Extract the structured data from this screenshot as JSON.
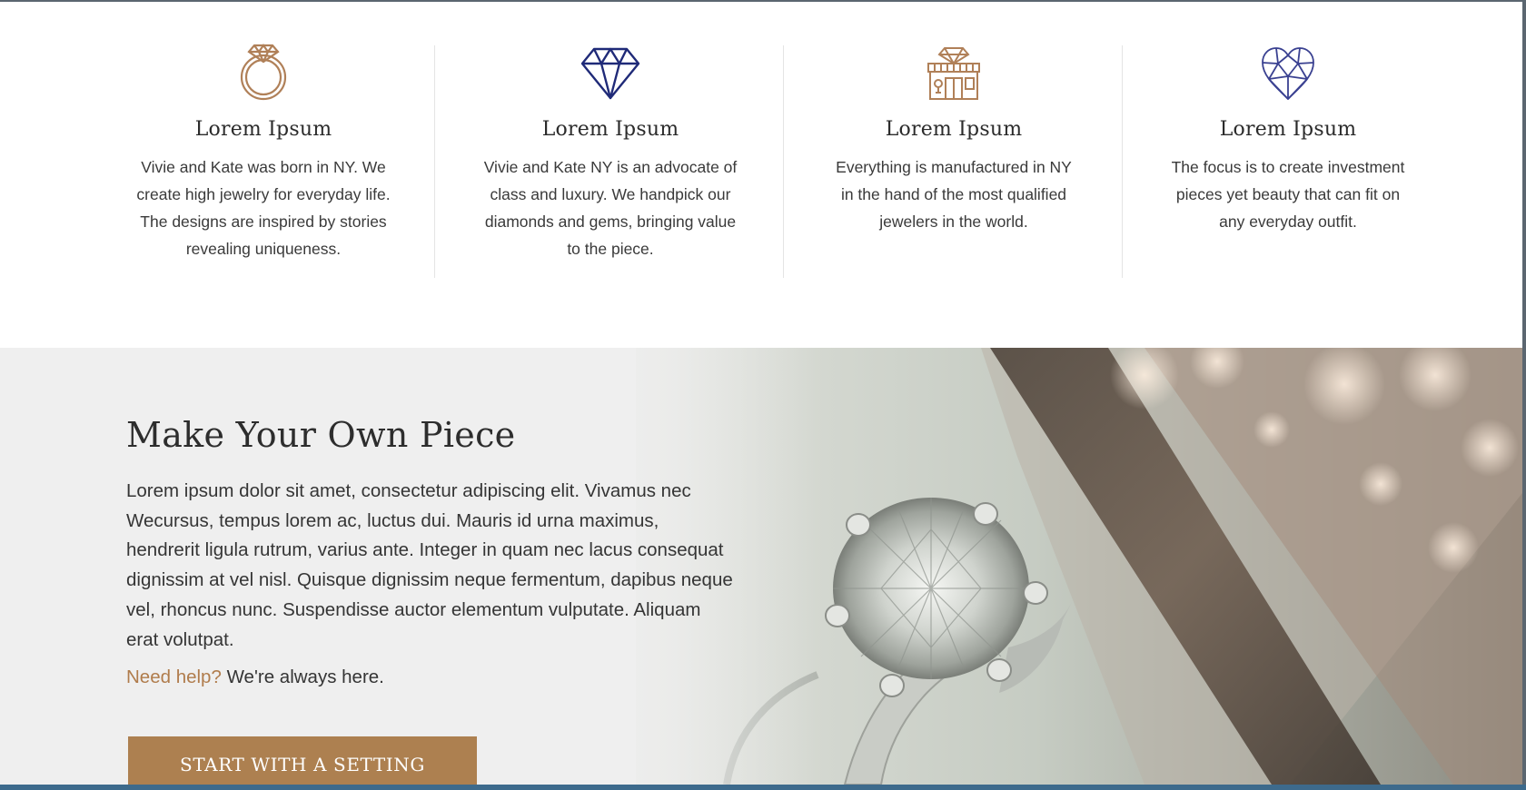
{
  "features": [
    {
      "icon": "ring-icon",
      "title": "Lorem Ipsum",
      "lines": [
        "Vivie and Kate was born in NY. We",
        "create high jewelry for everyday life.",
        "The designs are inspired by stories",
        "revealing uniqueness."
      ]
    },
    {
      "icon": "diamond-icon",
      "title": "Lorem Ipsum",
      "lines": [
        "Vivie and Kate NY is an advocate of",
        "class and luxury. We handpick our",
        "diamonds and gems, bringing value",
        "to the piece."
      ]
    },
    {
      "icon": "jewelry-store-icon",
      "title": "Lorem Ipsum",
      "lines": [
        "Everything is manufactured in NY",
        "in the hand of the most qualified",
        "jewelers in the world."
      ]
    },
    {
      "icon": "heart-diamond-icon",
      "title": "Lorem Ipsum",
      "lines": [
        "The focus is to create investment",
        "pieces yet beauty that can fit on",
        "any everyday outfit."
      ]
    }
  ],
  "hero": {
    "heading": "Make Your Own Piece",
    "body": "Lorem ipsum dolor sit amet, consectetur adipiscing elit. Vivamus nec Wecursus, tempus lorem ac, luctus dui. Mauris id urna maximus, hendrerit ligula rutrum, varius ante. Integer in quam nec lacus consequat dignissim at vel nisl. Quisque dignissim neque fermentum, dapibus neque vel, rhoncus nunc. Suspendisse auctor elementum vulputate. Aliquam erat volutpat.",
    "help_link": "Need help?",
    "help_text": " We're always here.",
    "cta_label": "START WITH A SETTING",
    "image": "diamond-ring-photo"
  },
  "colors": {
    "accent_gold": "#ad8050",
    "icon_gold": "#b08058",
    "icon_navy": "#1f2a78",
    "icon_indigo": "#3a4191",
    "hero_bg": "#efefef"
  }
}
